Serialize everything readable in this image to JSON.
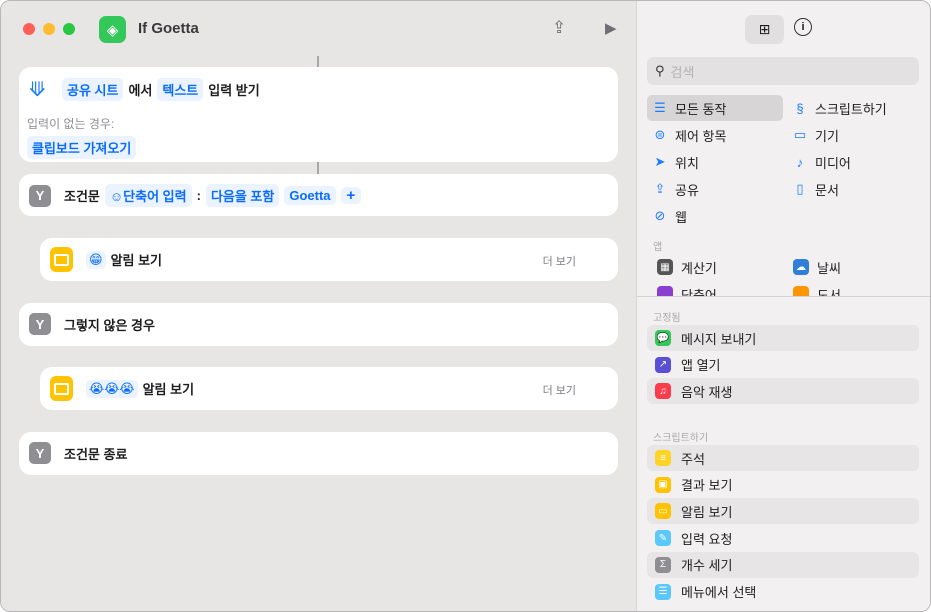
{
  "window": {
    "title": "If Goetta"
  },
  "editor": {
    "receive": {
      "source": "공유 시트",
      "from": "에서",
      "type": "텍스트",
      "action": "입력 받기",
      "no_input_label": "입력이 없는 경우:",
      "fallback": "클립보드 가져오기"
    },
    "if": {
      "label": "조건문",
      "variable": "단축어 입력",
      "colon": ":",
      "condition": "다음을 포함",
      "value": "Goetta",
      "add": "+"
    },
    "alert1": {
      "emoji": "😁",
      "label": "알림 보기",
      "more": "더 보기"
    },
    "otherwise": {
      "label": "그렇지 않은 경우"
    },
    "alert2": {
      "emoji": "😭😭😭",
      "label": "알림 보기",
      "more": "더 보기"
    },
    "endif": {
      "label": "조건문 종료"
    }
  },
  "sidebar": {
    "search_placeholder": "검색",
    "categories": [
      {
        "label": "모든 동작",
        "icon": "list-icon"
      },
      {
        "label": "스크립트하기",
        "icon": "scripting-icon"
      },
      {
        "label": "제어 항목",
        "icon": "toggle-icon"
      },
      {
        "label": "기기",
        "icon": "display-icon"
      },
      {
        "label": "위치",
        "icon": "location-icon"
      },
      {
        "label": "미디어",
        "icon": "music-note-icon"
      },
      {
        "label": "공유",
        "icon": "share-icon"
      },
      {
        "label": "문서",
        "icon": "document-icon"
      },
      {
        "label": "웹",
        "icon": "compass-icon"
      }
    ],
    "apps_label": "앱",
    "apps": [
      {
        "label": "계산기"
      },
      {
        "label": "날씨"
      },
      {
        "label": "단축어"
      },
      {
        "label": "도서"
      }
    ],
    "pinned_label": "고정됨",
    "pinned": [
      {
        "label": "메시지 보내기",
        "color": "#34c759"
      },
      {
        "label": "앱 열기",
        "color": "#5b4fd6"
      },
      {
        "label": "음악 재생",
        "color": "#fa3c4c"
      }
    ],
    "scripting_label": "스크립트하기",
    "scripting": [
      {
        "label": "주석",
        "color": "#ffd426"
      },
      {
        "label": "결과 보기",
        "color": "#ffc300"
      },
      {
        "label": "알림 보기",
        "color": "#ffc300"
      },
      {
        "label": "입력 요청",
        "color": "#5ac8fa"
      },
      {
        "label": "개수 세기",
        "color": "#8e8e93"
      },
      {
        "label": "메뉴에서 선택",
        "color": "#5ac8fa"
      }
    ]
  }
}
